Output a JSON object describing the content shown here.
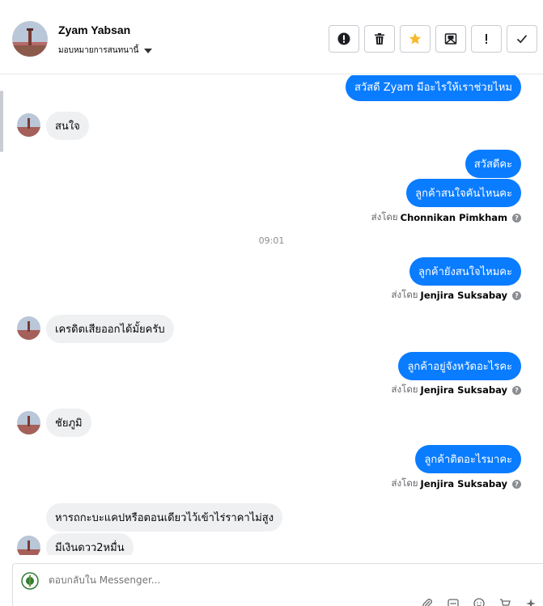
{
  "header": {
    "contact_name": "Zyam Yabsan",
    "assign_label": "มอบหมายการสนทนานี้"
  },
  "actions": [
    {
      "name": "spam-button",
      "icon": "exclamation-circle-icon"
    },
    {
      "name": "delete-button",
      "icon": "trash-icon"
    },
    {
      "name": "star-button",
      "icon": "star-icon"
    },
    {
      "name": "mark-unread-button",
      "icon": "envelope-icon"
    },
    {
      "name": "follow-up-button",
      "icon": "exclamation-icon"
    },
    {
      "name": "mark-done-button",
      "icon": "checkmark-icon"
    }
  ],
  "colors": {
    "outgoing_bubble": "#0a7cff",
    "incoming_bubble": "#eff0f2",
    "star": "#f7b928"
  },
  "messages": {
    "m1": "สวัสดี Zyam มีอะไรให้เราช่วยไหม",
    "m2": "สนใจ",
    "m3": "สวัสดีคะ",
    "m4": "ลูกค้าสนใจคันไหนคะ",
    "m4_sent_prefix": "ส่งโดย",
    "m4_agent": "Chonnikan Pimkham",
    "time1": "09:01",
    "m5": "ลูกค้ายังสนใจไหมคะ",
    "m5_sent_prefix": "ส่งโดย",
    "m5_agent": "Jenjira Suksabay",
    "m6": "เครดิตเสียออกได้มั้ยครับ",
    "m7": "ลูกค้าอยู่จังหวัดอะไรคะ",
    "m7_sent_prefix": "ส่งโดย",
    "m7_agent": "Jenjira Suksabay",
    "m8": "ชัยภูมิ",
    "m9": "ลูกค้าติดอะไรมาคะ",
    "m9_sent_prefix": "ส่งโดย",
    "m9_agent": "Jenjira Suksabay",
    "m10": "หารถกะบะแคปหรือตอนเดียวไว้เข้าไร่ราคาไม่สูง",
    "m11": "มีเงินดวว2หมื่น"
  },
  "composer": {
    "placeholder": "ตอบกลับใน Messenger..."
  }
}
